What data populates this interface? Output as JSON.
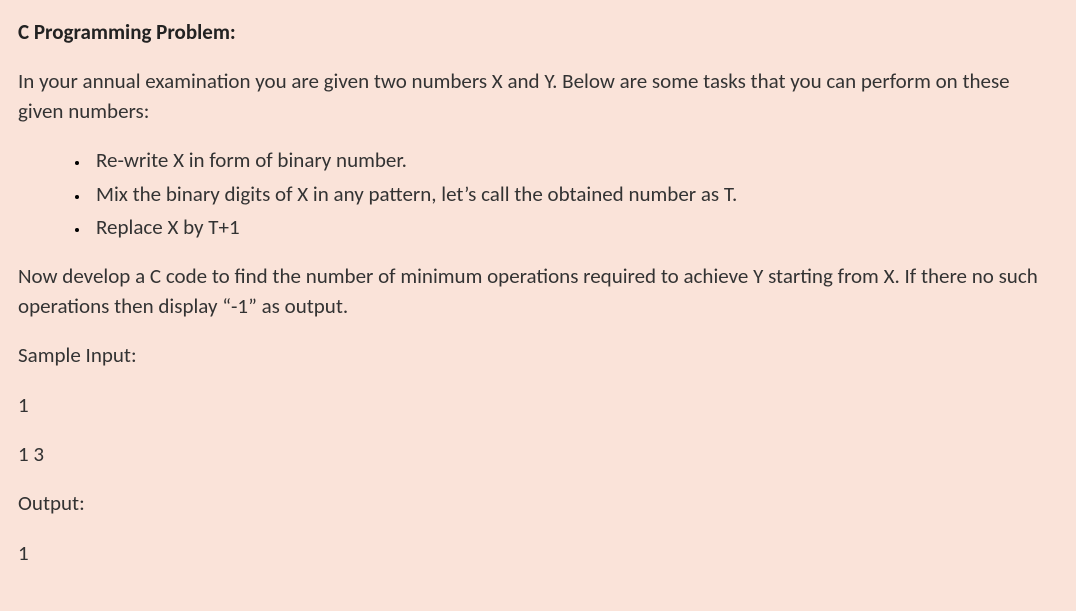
{
  "title": "C Programming Problem:",
  "intro": "In your annual examination you are given two numbers X and Y. Below are some tasks that you can perform on these given numbers:",
  "bullets": [
    "Re-write X in form of binary number.",
    "Mix the binary digits of X in any pattern, let’s call the obtained number as T.",
    "Replace X by T+1"
  ],
  "task": "Now develop a C code to find the number of minimum operations required to achieve Y starting from X. If there no such operations then display “-1” as output.",
  "sample_input_label": "Sample Input:",
  "sample_input_line1": "1",
  "sample_input_line2": "1 3",
  "output_label": "Output:",
  "output_line1": "1"
}
